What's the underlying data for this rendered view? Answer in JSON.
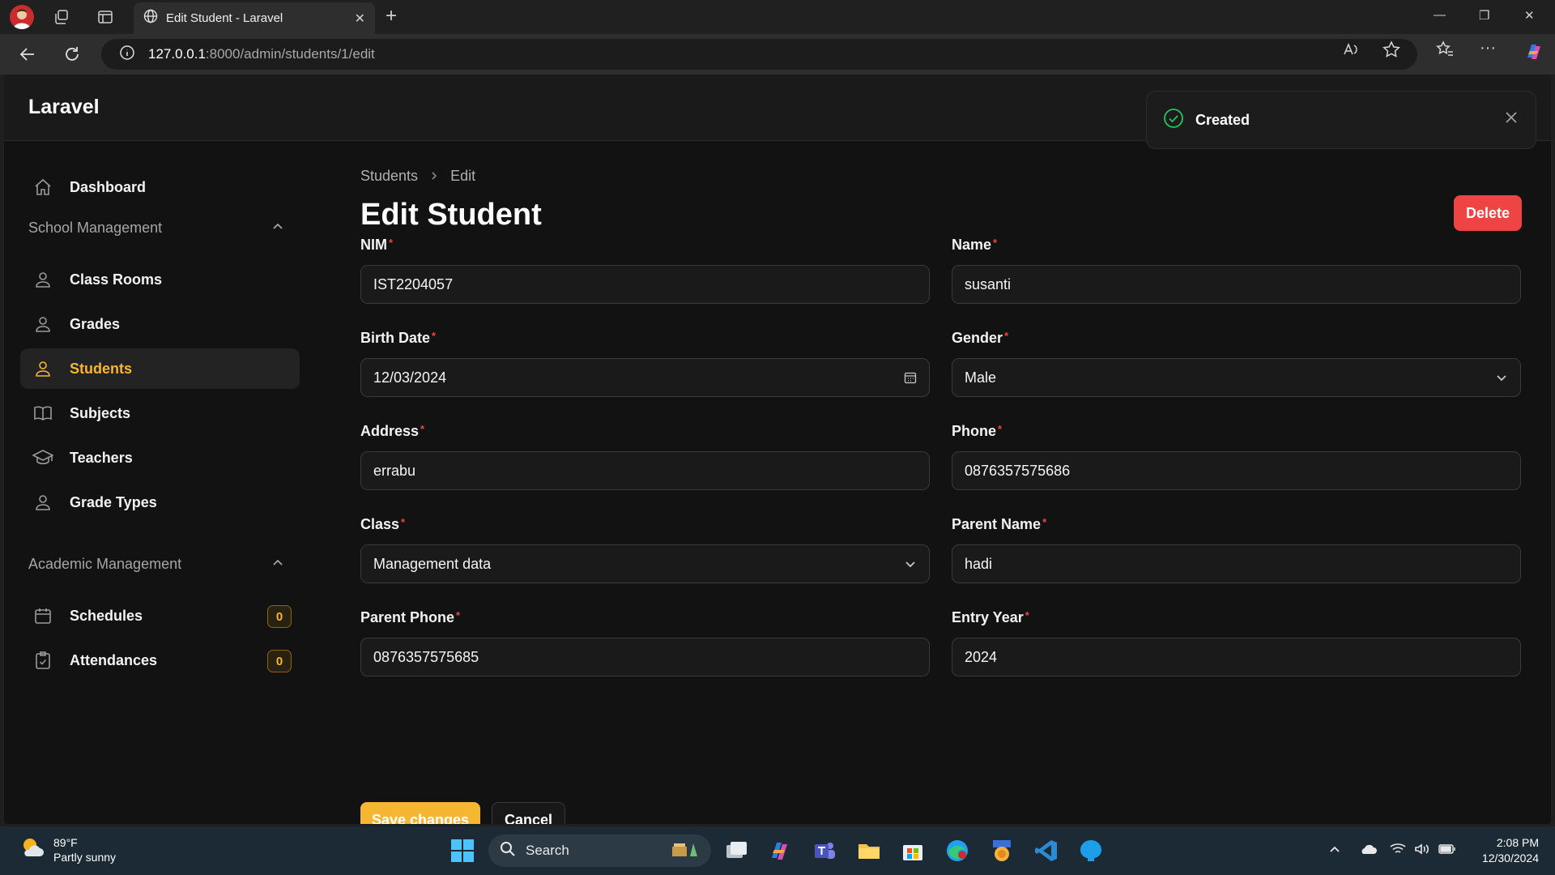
{
  "browser": {
    "tab_title": "Edit Student - Laravel",
    "url_host": "127.0.0.1",
    "url_path": ":8000/admin/students/1/edit"
  },
  "app": {
    "brand": "Laravel"
  },
  "toast": {
    "message": "Created"
  },
  "sidebar": {
    "dashboard": "Dashboard",
    "groups": [
      {
        "label": "School Management",
        "items": [
          {
            "label": "Class Rooms",
            "icon": "person-icon"
          },
          {
            "label": "Grades",
            "icon": "person-icon"
          },
          {
            "label": "Students",
            "icon": "person-icon",
            "active": true
          },
          {
            "label": "Subjects",
            "icon": "book-icon"
          },
          {
            "label": "Teachers",
            "icon": "graduation-cap-icon"
          },
          {
            "label": "Grade Types",
            "icon": "person-icon"
          }
        ]
      },
      {
        "label": "Academic Management",
        "items": [
          {
            "label": "Schedules",
            "icon": "calendar-icon",
            "badge": "0"
          },
          {
            "label": "Attendances",
            "icon": "clipboard-icon",
            "badge": "0"
          }
        ]
      }
    ]
  },
  "breadcrumb": {
    "items": [
      "Students",
      "Edit"
    ]
  },
  "page": {
    "title": "Edit Student",
    "delete_label": "Delete"
  },
  "form": {
    "fields": [
      {
        "label": "NIM",
        "value": "IST2204057",
        "type": "text"
      },
      {
        "label": "Name",
        "value": "susanti",
        "type": "text"
      },
      {
        "label": "Birth Date",
        "value": "12/03/2024",
        "type": "date"
      },
      {
        "label": "Gender",
        "value": "Male",
        "type": "select"
      },
      {
        "label": "Address",
        "value": "errabu",
        "type": "text"
      },
      {
        "label": "Phone",
        "value": "0876357575686",
        "type": "text"
      },
      {
        "label": "Class",
        "value": "Management data",
        "type": "select"
      },
      {
        "label": "Parent Name",
        "value": "hadi",
        "type": "text"
      },
      {
        "label": "Parent Phone",
        "value": "0876357575685",
        "type": "text"
      },
      {
        "label": "Entry Year",
        "value": "2024",
        "type": "text"
      }
    ],
    "required_mark": "*",
    "save_label": "Save changes",
    "cancel_label": "Cancel"
  },
  "taskbar": {
    "weather_temp": "89°F",
    "weather_desc": "Partly sunny",
    "search_label": "Search",
    "time": "2:08 PM",
    "date": "12/30/2024"
  },
  "colors": {
    "accent": "#f5b731",
    "danger": "#ef4444",
    "background": "#121212"
  }
}
